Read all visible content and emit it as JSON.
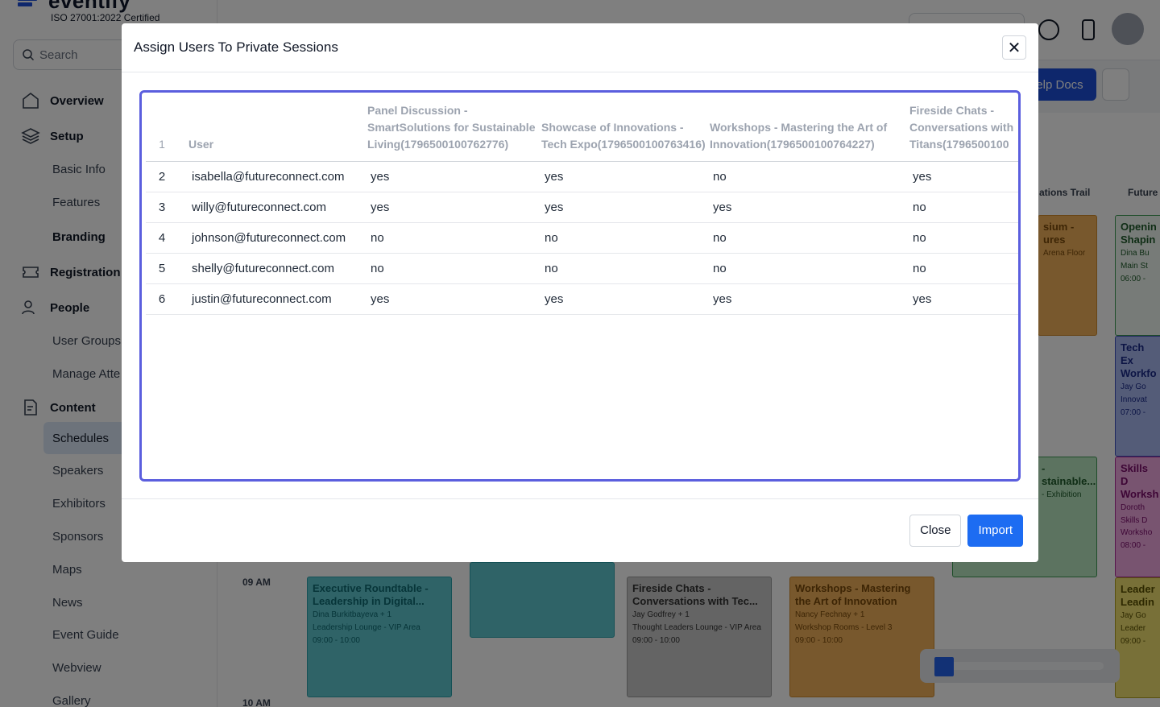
{
  "app": {
    "logo_text": "eventify",
    "certification": "ISO 27001:2022 Certified",
    "search_placeholder": "Search"
  },
  "sidebar": {
    "groups": {
      "overview": "Overview",
      "setup": "Setup",
      "registration": "Registration",
      "people": "People",
      "content": "Content"
    },
    "items": {
      "basic_info": "Basic Info",
      "features": "Features",
      "branding": "Branding",
      "user_groups": "User Groups",
      "manage_attendees": "Manage Atte",
      "schedules": "Schedules",
      "speakers": "Speakers",
      "exhibitors": "Exhibitors",
      "sponsors": "Sponsors",
      "maps": "Maps",
      "news": "News",
      "event_guide": "Event Guide",
      "webview": "Webview",
      "gallery": "Gallery"
    }
  },
  "topbar": {
    "help_docs": "elp Docs"
  },
  "schedule": {
    "times": [
      "09 AM",
      "10 AM"
    ],
    "columns": [
      "ations Trail",
      "Future"
    ],
    "cards": [
      {
        "title": "Executive Roundtable - Leadership in Digital...",
        "speaker": "Dina Burkitbayeva + 1",
        "location": "Leadership Lounge - VIP Area",
        "time": "09:00 - 10:00"
      },
      {
        "title": "Fireside Chats - Conversations with Tec...",
        "speaker": "Jay Godfrey + 1",
        "location": "Thought Leaders Lounge - VIP Area",
        "time": "09:00 - 10:00"
      },
      {
        "title": "Workshops - Mastering the Art of Innovation",
        "speaker": "Nancy Fechnay + 1",
        "location": "Workshop Rooms - Level 3",
        "time": "09:00 - 10:00"
      },
      {
        "title": "sium - ures",
        "location": "Arena Floor"
      },
      {
        "title": "- stainable...",
        "location": "- Exhibition"
      },
      {
        "title": "Openin Shapin",
        "speaker": "Dina Bu",
        "location": "Main St",
        "time": "06:00 -"
      },
      {
        "title": "Tech Ex Workfo",
        "speaker": "Jay Go",
        "location": "Innovat",
        "time": "07:00 -"
      },
      {
        "title": "Skills D Worksh",
        "speaker": "Doroth",
        "location": "Skills D Worksho",
        "time": "08:00 -"
      },
      {
        "title": "Leader Leadin",
        "speaker": "Jay Go",
        "location": "Leader",
        "time": "09:00 -"
      }
    ],
    "upload_progress": 0.1
  },
  "modal": {
    "title": "Assign Users To Private Sessions",
    "close_label": "Close",
    "import_label": "Import",
    "table": {
      "header_row_number": "1",
      "headers": [
        "User",
        "Panel Discussion - SmartSolutions for Sustainable Living(1796500100762776)",
        "Showcase of Innovations - Tech Expo(1796500100763416)",
        "Workshops - Mastering the Art of Innovation(1796500100764227)",
        "Fireside Chats - Conversations with Titans(1796500100"
      ],
      "rows": [
        {
          "n": "2",
          "user": "isabella@futureconnect.com",
          "v": [
            "yes",
            "yes",
            "no",
            "yes"
          ]
        },
        {
          "n": "3",
          "user": "willy@futureconnect.com",
          "v": [
            "yes",
            "yes",
            "yes",
            "no"
          ]
        },
        {
          "n": "4",
          "user": "johnson@futureconnect.com",
          "v": [
            "no",
            "no",
            "no",
            "no"
          ]
        },
        {
          "n": "5",
          "user": "shelly@futureconnect.com",
          "v": [
            "no",
            "no",
            "no",
            "no"
          ]
        },
        {
          "n": "6",
          "user": "justin@futureconnect.com",
          "v": [
            "yes",
            "yes",
            "yes",
            "yes"
          ]
        }
      ]
    }
  },
  "colors": {
    "primary": "#1d6cf2",
    "sheet_border": "#5b5ede",
    "overlay": "rgba(0,0,0,0.5)"
  }
}
